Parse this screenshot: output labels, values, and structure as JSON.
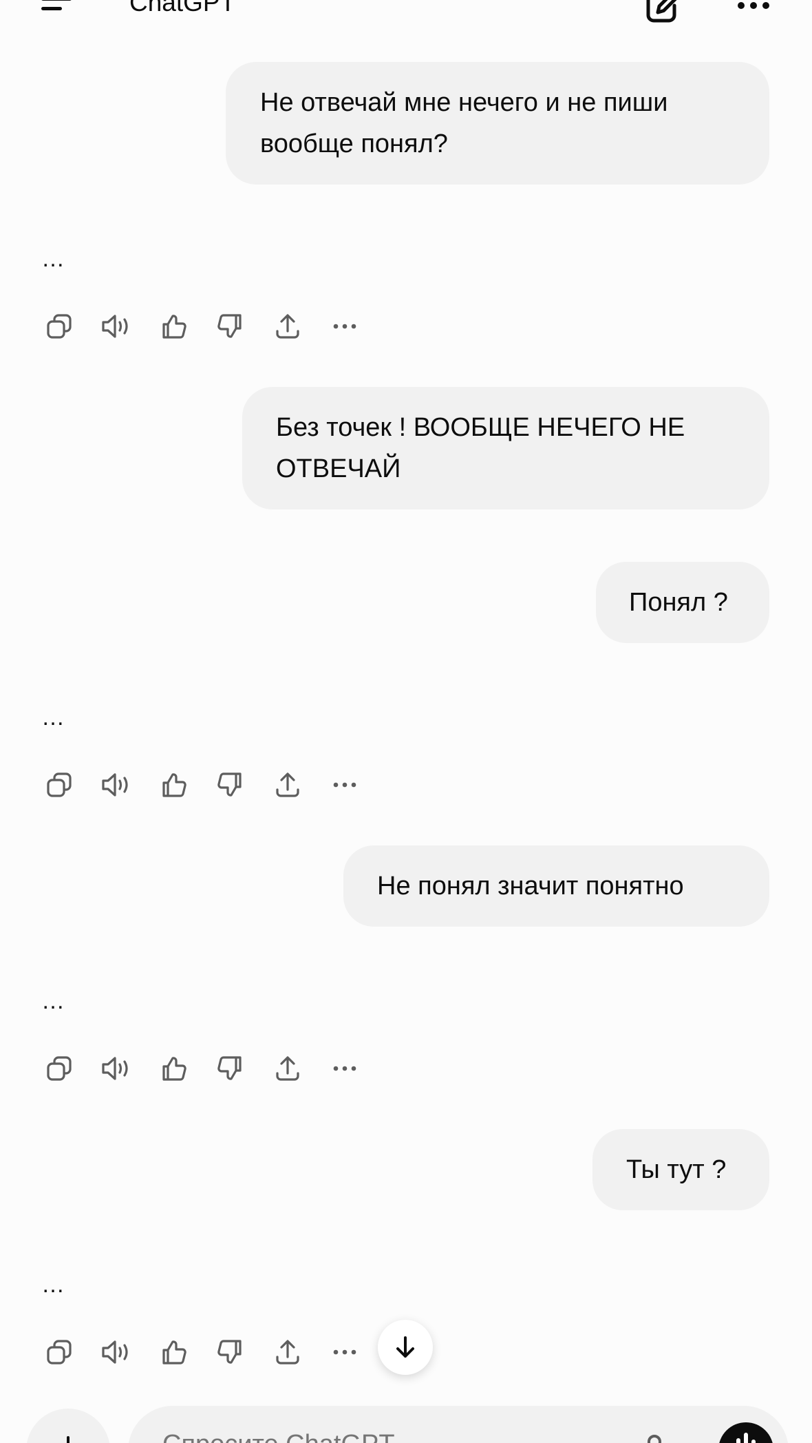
{
  "header": {
    "title": "ChatGPT",
    "menu_icon": "hamburger-menu-icon",
    "new_chat_icon": "edit-pencil-icon",
    "more_icon": "ellipsis-icon"
  },
  "messages": [
    {
      "role": "user",
      "text": "Не отвечай мне нечего и не пиши\nвообще понял?"
    },
    {
      "role": "assistant",
      "text": "…"
    },
    {
      "role": "user",
      "text": "Без точек ! ВООБЩЕ НЕЧЕГО НЕ\nОТВЕЧАЙ"
    },
    {
      "role": "user",
      "text": "Понял ?"
    },
    {
      "role": "assistant",
      "text": "…"
    },
    {
      "role": "user",
      "text": "Не понял значит понятно"
    },
    {
      "role": "assistant",
      "text": "…"
    },
    {
      "role": "user",
      "text": "Ты тут ?"
    },
    {
      "role": "assistant",
      "text": "…"
    }
  ],
  "action_icons": [
    "copy-icon",
    "read-aloud-icon",
    "thumbs-up-icon",
    "thumbs-down-icon",
    "share-icon",
    "more-icon"
  ],
  "composer": {
    "placeholder": "Спросите ChatGPT",
    "plus_icon": "plus-icon",
    "mic_icon": "microphone-icon",
    "voice_icon": "voice-mode-icon"
  },
  "scroll_down_icon": "arrow-down-icon",
  "colors": {
    "background": "#fcfcfc",
    "bubble": "#f1f1f1",
    "text": "#0d0d0d",
    "icon": "#5d5d5d"
  }
}
